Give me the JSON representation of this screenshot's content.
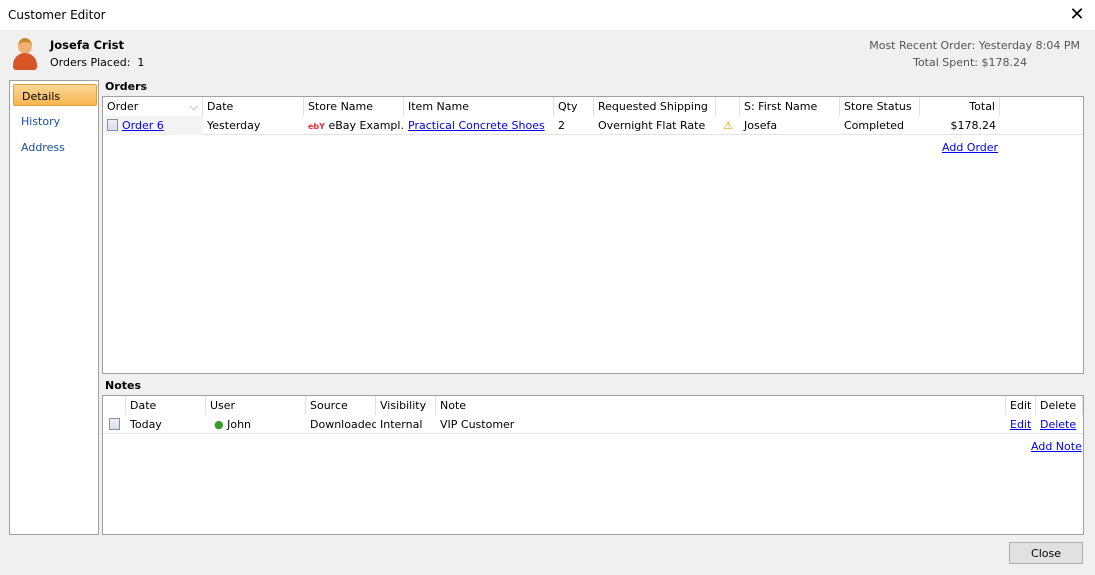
{
  "window": {
    "title": "Customer Editor"
  },
  "customer": {
    "name": "Josefa Crist",
    "orders_placed_label": "Orders Placed:",
    "orders_placed": "1",
    "most_recent": "Most Recent Order: Yesterday 8:04 PM",
    "total_spent": "Total Spent: $178.24"
  },
  "nav": [
    {
      "label": "Details"
    },
    {
      "label": "History"
    },
    {
      "label": "Address"
    }
  ],
  "orders": {
    "title": "Orders",
    "columns": [
      "Order",
      "Date",
      "Store Name",
      "Item Name",
      "Qty",
      "Requested Shipping",
      "",
      "S: First Name",
      "Store Status",
      "Total"
    ],
    "rows": [
      {
        "order": "Order 6",
        "date": "Yesterday",
        "store_logo": "ebY",
        "store": "eBay Exampl...",
        "item": "Practical Concrete Shoes",
        "qty": "2",
        "shipping": "Overnight Flat Rate",
        "first_name": "Josefa",
        "status": "Completed",
        "total": "$178.24"
      }
    ],
    "add_label": "Add Order"
  },
  "notes": {
    "title": "Notes",
    "columns": [
      "",
      "Date",
      "User",
      "Source",
      "Visibility",
      "Note",
      "Edit",
      "Delete"
    ],
    "rows": [
      {
        "date": "Today",
        "user": "John",
        "source": "Downloaded",
        "visibility": "Internal",
        "note": "VIP Customer",
        "edit": "Edit",
        "delete": "Delete"
      }
    ],
    "add_label": "Add Note"
  },
  "close_label": "Close"
}
